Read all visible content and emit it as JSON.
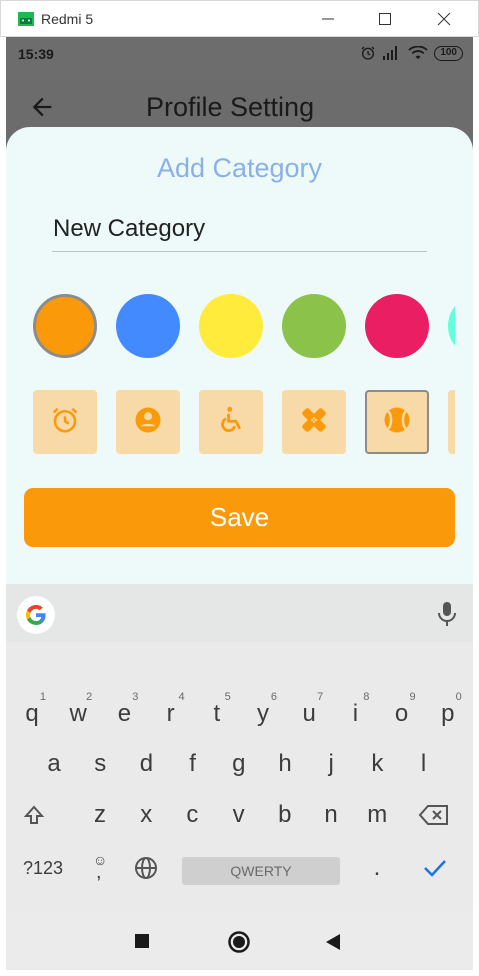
{
  "window": {
    "title": "Redmi 5",
    "minimize_icon": "minimize-icon",
    "maximize_icon": "maximize-icon",
    "close_icon": "close-icon"
  },
  "status_bar": {
    "time": "15:39",
    "battery": "100",
    "icons": [
      "alarm-icon",
      "signal-icon",
      "wifi-icon"
    ]
  },
  "app_bar": {
    "title": "Profile Setting",
    "back_icon": "back-arrow-icon"
  },
  "dialog": {
    "title": "Add Category",
    "name_value": "New Category",
    "colors": [
      "#fa9a0a",
      "#448aff",
      "#ffeb3b",
      "#8bc34a",
      "#e91e63",
      "#64ffda"
    ],
    "selected_color_index": 0,
    "icons": [
      "alarm-icon",
      "account-circle-icon",
      "accessible-icon",
      "healing-icon",
      "sports-ball-icon",
      "extra-icon"
    ],
    "icon_color": "#fa9a0a",
    "tile_color": "#f8d9a8",
    "selected_icon_index": 4,
    "save_label": "Save"
  },
  "keyboard": {
    "row1": [
      {
        "k": "q",
        "h": "1"
      },
      {
        "k": "w",
        "h": "2"
      },
      {
        "k": "e",
        "h": "3"
      },
      {
        "k": "r",
        "h": "4"
      },
      {
        "k": "t",
        "h": "5"
      },
      {
        "k": "y",
        "h": "6"
      },
      {
        "k": "u",
        "h": "7"
      },
      {
        "k": "i",
        "h": "8"
      },
      {
        "k": "o",
        "h": "9"
      },
      {
        "k": "p",
        "h": "0"
      }
    ],
    "row2": [
      "a",
      "s",
      "d",
      "f",
      "g",
      "h",
      "j",
      "k",
      "l"
    ],
    "row3": [
      "z",
      "x",
      "c",
      "v",
      "b",
      "n",
      "m"
    ],
    "symbols_label": "?123",
    "emoji_label": "☺",
    "comma_label": ",",
    "space_label": "QWERTY",
    "period_label": ".",
    "shift_icon": "shift-icon",
    "backspace_icon": "backspace-icon",
    "globe_icon": "globe-icon",
    "enter_icon": "checkmark-icon",
    "google_icon": "google-icon",
    "mic_icon": "microphone-icon"
  },
  "nav_bar": {
    "recents_icon": "recents-square-icon",
    "home_icon": "home-circle-icon",
    "back_icon": "back-triangle-icon"
  }
}
